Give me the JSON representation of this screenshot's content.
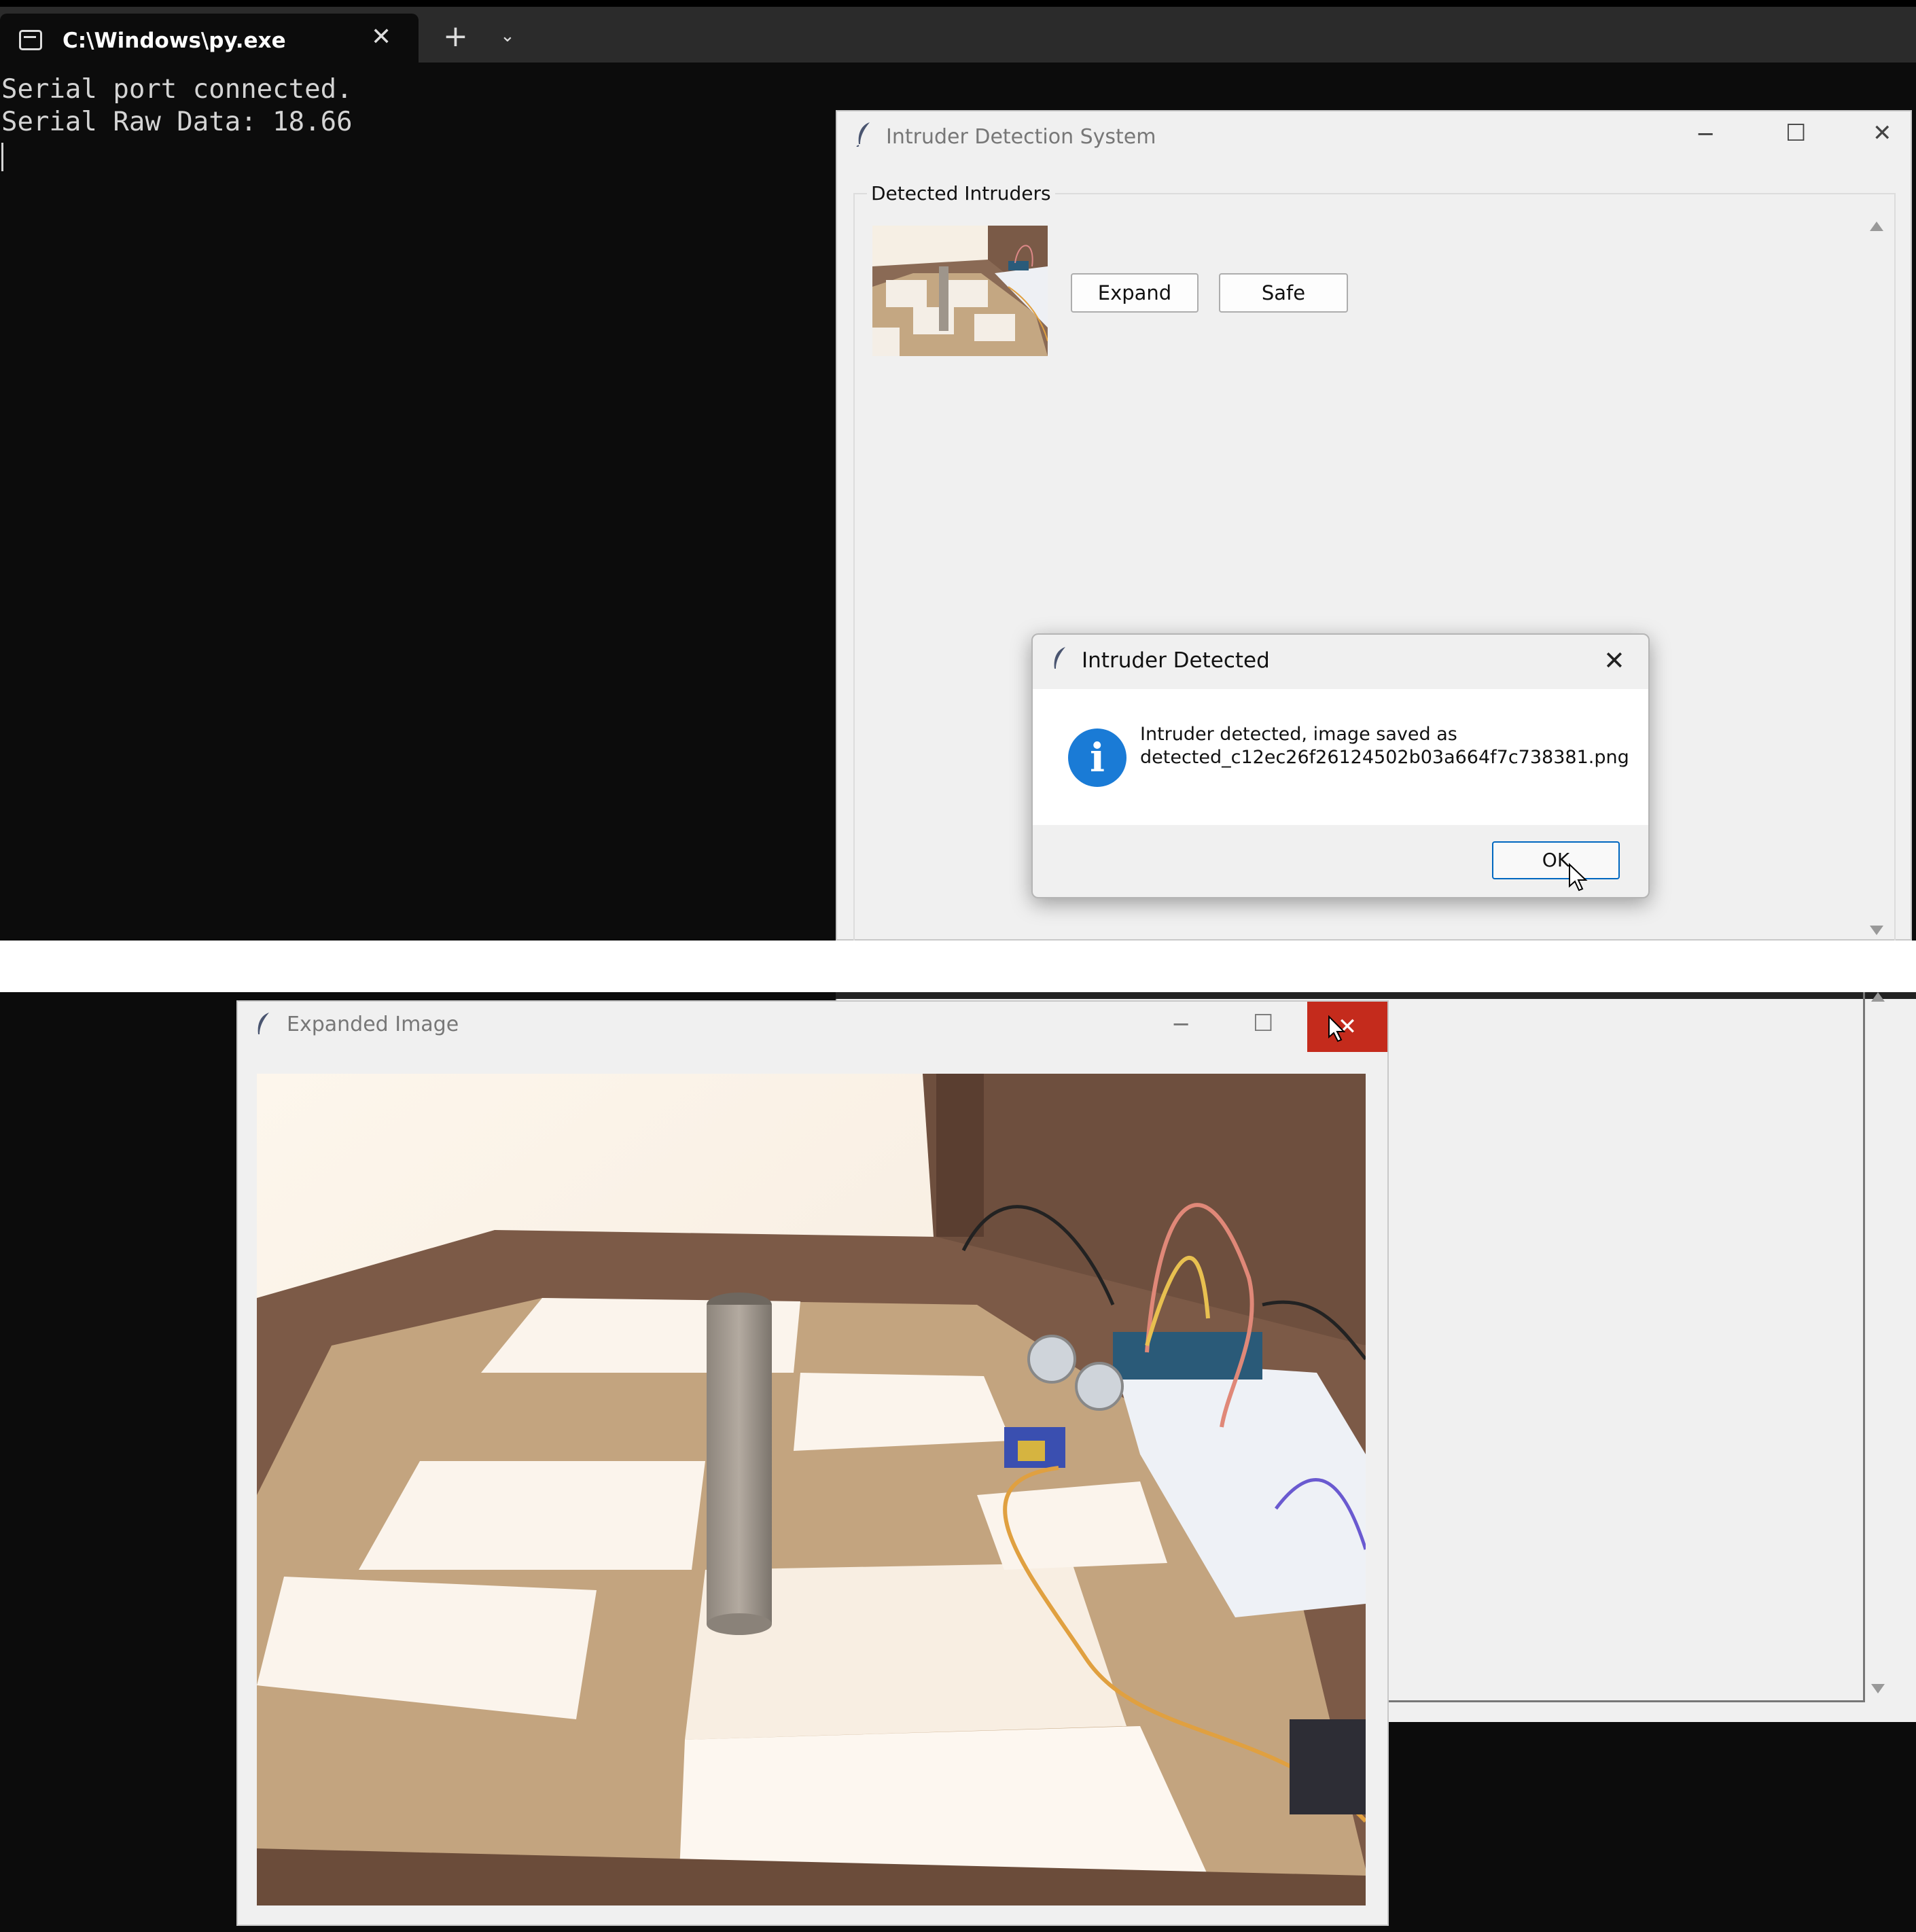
{
  "terminal": {
    "tab_title": "C:\\Windows\\py.exe",
    "lines": [
      "Serial port connected.",
      "Serial Raw Data: 18.66"
    ]
  },
  "ids_window": {
    "title": "Intruder Detection System",
    "frame_label": "Detected Intruders",
    "expand_label": "Expand",
    "safe_label": "Safe"
  },
  "message_box": {
    "title": "Intruder Detected",
    "text": "Intruder detected, image saved as\ndetected_c12ec26f26124502b03a664f7c738381.png",
    "ok_label": "OK"
  },
  "expanded_window": {
    "title": "Expanded Image"
  },
  "colors": {
    "close_hover": "#c42b1c",
    "info_blue": "#1a7bd6",
    "default_button_border": "#0067c0"
  },
  "icons": [
    "terminal-icon",
    "close-icon",
    "plus-icon",
    "chevron-down-icon",
    "tk-feather-icon",
    "minimize-icon",
    "maximize-icon",
    "info-icon",
    "mouse-cursor-icon"
  ]
}
